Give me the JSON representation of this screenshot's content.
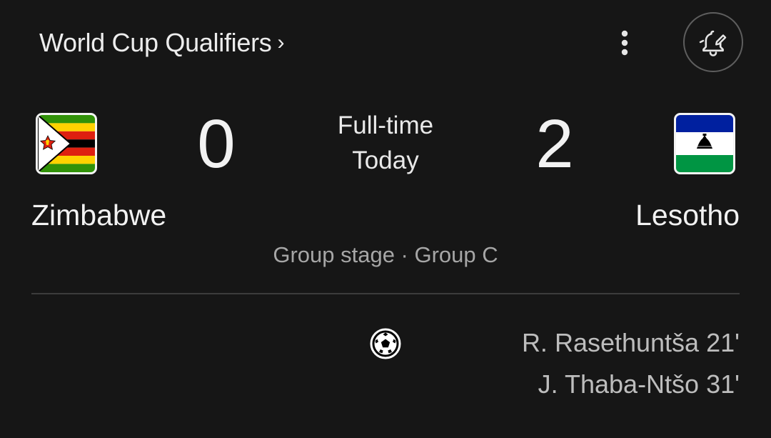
{
  "header": {
    "competition": "World Cup Qualifiers",
    "chevron": "›",
    "more_icon": "more-vert-icon",
    "bell_icon": "notification-bell-edit-icon"
  },
  "match": {
    "home": {
      "name": "Zimbabwe",
      "score": "0",
      "flag_icon": "zimbabwe-flag"
    },
    "away": {
      "name": "Lesotho",
      "score": "2",
      "flag_icon": "lesotho-flag"
    },
    "status": "Full-time",
    "date": "Today",
    "stage": "Group stage · Group C"
  },
  "events": {
    "goal_icon": "soccer-ball-icon",
    "away_scorers": [
      "R. Rasethuntša 21'",
      "J. Thaba-Ntšo 31'"
    ]
  },
  "colors": {
    "background": "#161616",
    "text_primary": "#f2f2f2",
    "text_secondary": "#a6a6a6",
    "divider": "#3c3c3c"
  }
}
